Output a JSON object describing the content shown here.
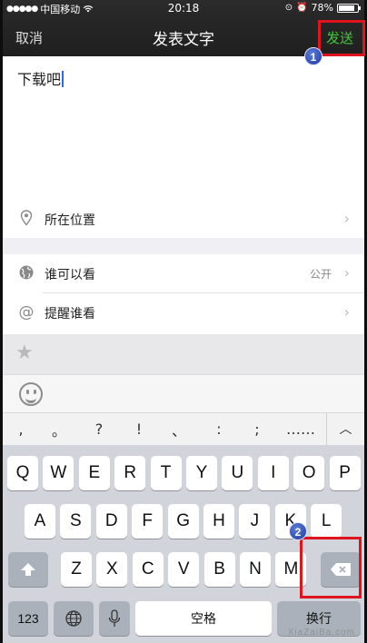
{
  "status_bar": {
    "carrier": "中国移动",
    "time": "20:18",
    "battery": "78%"
  },
  "nav": {
    "cancel": "取消",
    "title": "发表文字",
    "send": "发送"
  },
  "composer": {
    "text": "下载吧"
  },
  "rows": {
    "location": {
      "label": "所在位置",
      "icon": "location-pin-icon"
    },
    "visibility": {
      "label": "谁可以看",
      "value": "公开",
      "icon": "globe-icon"
    },
    "remind": {
      "label": "提醒谁看",
      "icon": "at-icon"
    }
  },
  "punctuation": [
    ",",
    "。",
    "?",
    "!",
    "、",
    ":",
    ";",
    "……"
  ],
  "keyboard": {
    "row1": [
      "Q",
      "W",
      "E",
      "R",
      "T",
      "Y",
      "U",
      "I",
      "O",
      "P"
    ],
    "row2": [
      "A",
      "S",
      "D",
      "F",
      "G",
      "H",
      "J",
      "K",
      "L"
    ],
    "row3": [
      "Z",
      "X",
      "C",
      "V",
      "B",
      "N",
      "M"
    ],
    "numbers": "123",
    "space": "空格",
    "return": "换行"
  },
  "markers": {
    "one": "1",
    "two": "2"
  },
  "highlight_color": "#e0141e",
  "send_color": "#41c83a"
}
